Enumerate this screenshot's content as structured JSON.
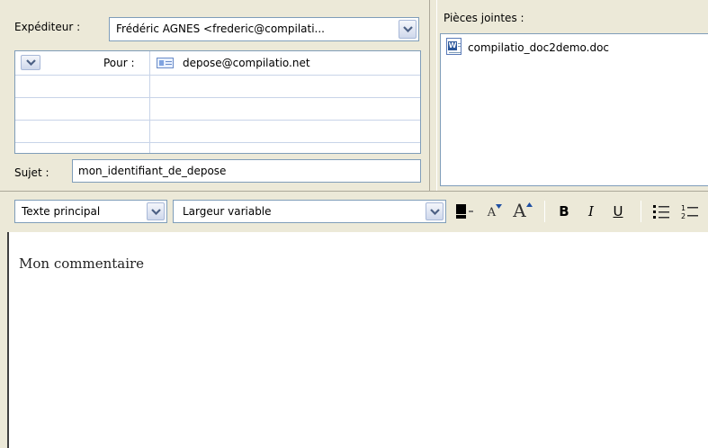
{
  "header": {
    "from_label": "Expéditeur :",
    "from_value": "Frédéric AGNES <frederic@compilati...",
    "to_label": "Pour :",
    "to_value": "depose@compilatio.net",
    "subject_label": "Sujet :",
    "subject_value": "mon_identifiant_de_depose"
  },
  "attachments": {
    "label": "Pièces jointes :",
    "items": [
      {
        "name": "compilatio_doc2demo.doc",
        "icon": "word-doc-icon"
      }
    ]
  },
  "format_toolbar": {
    "style_value": "Texte principal",
    "font_value": "Largeur variable",
    "bold": "B",
    "italic": "I",
    "underline": "U",
    "font_decrease": "A",
    "font_increase": "A"
  },
  "body": {
    "text": "Mon commentaire"
  },
  "colors": {
    "field_border": "#7f9db9",
    "panel_bg": "#ece9d8",
    "dropdown_arrow": "#4d6185"
  }
}
